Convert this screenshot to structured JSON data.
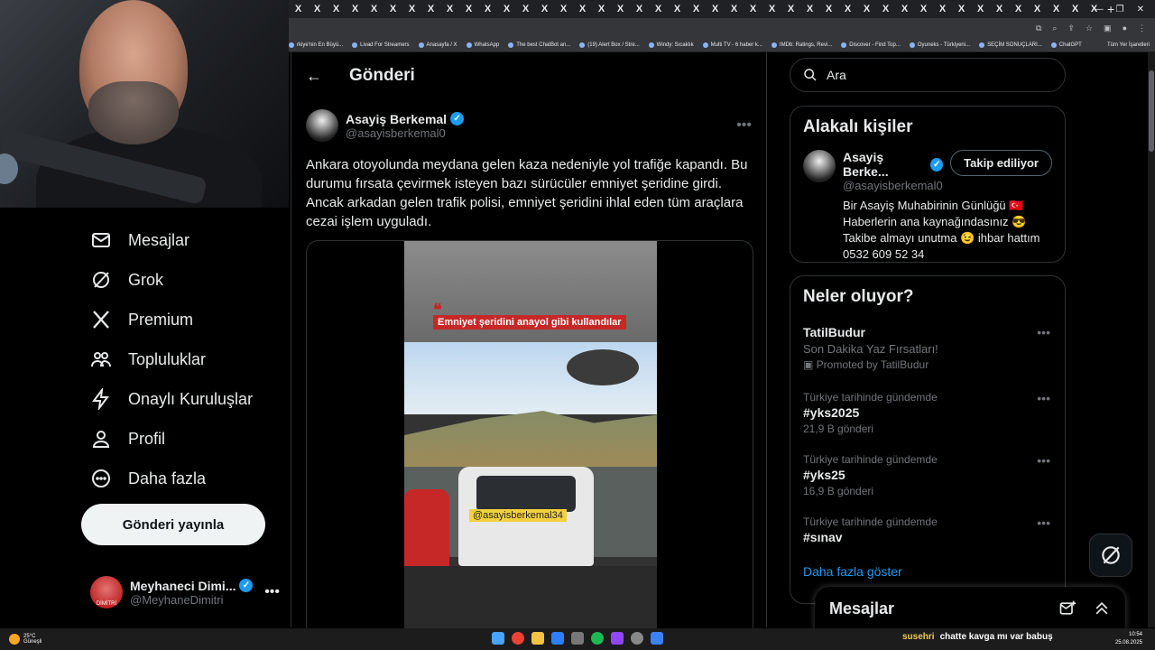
{
  "browser": {
    "tabs": [
      "X",
      "X",
      "X",
      "X",
      "X",
      "X",
      "X",
      "X",
      "X",
      "X",
      "X",
      "X",
      "X",
      "X",
      "X",
      "X",
      "X",
      "X",
      "X",
      "X",
      "X",
      "X",
      "X",
      "X",
      "X",
      "X",
      "X",
      "X",
      "X",
      "X",
      "X",
      "X",
      "X",
      "X",
      "X",
      "X",
      "X",
      "X",
      "X",
      "X",
      "X",
      "X",
      "X"
    ],
    "bookmarks": [
      "rkiye'nin En Büyü...",
      "Livad For Streamers",
      "Anasayfa / X",
      "WhatsApp",
      "The best ChatBot an...",
      "(19) Alert Box / Stre...",
      "Windy: Sıcaklık",
      "Multi TV - 6 haber k...",
      "IMDb: Ratings, Revi...",
      "Discover - Find Top...",
      "Oyuneks - Türkiyeni...",
      "SEÇİM SONUÇLARI...",
      "ChatGPT"
    ],
    "bookmarks_right": "Tüm Yer İşaretleri"
  },
  "nav": {
    "items": [
      {
        "label": "Mesajlar",
        "icon": "mail-icon"
      },
      {
        "label": "Grok",
        "icon": "grok-icon"
      },
      {
        "label": "Premium",
        "icon": "x-logo-icon"
      },
      {
        "label": "Topluluklar",
        "icon": "people-icon"
      },
      {
        "label": "Onaylı Kuruluşlar",
        "icon": "lightning-icon"
      },
      {
        "label": "Profil",
        "icon": "person-icon"
      },
      {
        "label": "Daha fazla",
        "icon": "more-circle-icon"
      }
    ],
    "post_button": "Gönderi yayınla",
    "account": {
      "name": "Meyhaneci Dimi...",
      "handle": "@MeyhaneDimitri",
      "avatar_text": "DİMİTRİ"
    }
  },
  "main": {
    "title": "Gönderi",
    "tweet": {
      "author": "Asayiş Berkemal",
      "handle": "@asayisberkemal0",
      "text": "Ankara otoyolunda meydana gelen kaza nedeniyle yol trafiğe kapandı. Bu durumu fırsata çevirmek isteyen bazı sürücüler emniyet şeridine girdi. Ancak arkadan gelen trafik polisi, emniyet şeridini ihlal eden tüm araçlara cezai işlem uyguladı.",
      "video_banner": "Emniyet şeridini anayol gibi kullandılar",
      "video_handle": "@asayisberkemal34"
    }
  },
  "search": {
    "placeholder": "Ara"
  },
  "related": {
    "title": "Alakalı kişiler",
    "person": {
      "name": "Asayiş Berke...",
      "handle": "@asayisberkemal0",
      "follow_label": "Takip ediliyor",
      "bio_line1": "Bir Asayiş Muhabirinin Günlüğü 🇹🇷",
      "bio_line2": "Haberlerin ana kaynağındasınız 😎",
      "bio_line3": "Takibe almayı unutma 😉 ihbar hattım",
      "bio_line4": "0532 609 52 34"
    }
  },
  "trends": {
    "title": "Neler oluyor?",
    "items": [
      {
        "context": "",
        "name": "TatilBudur",
        "sub": "Son Dakika Yaz Fırsatları!",
        "meta": "Promoted by TatilBudur"
      },
      {
        "context": "Türkiye tarihinde gündemde",
        "name": "#yks2025",
        "sub": "21,9 B gönderi"
      },
      {
        "context": "Türkiye tarihinde gündemde",
        "name": "#yks25",
        "sub": "16,9 B gönderi"
      },
      {
        "context": "Türkiye tarihinde gündemde",
        "name": "#sınav",
        "sub": ""
      }
    ],
    "show_more": "Daha fazla göster"
  },
  "messages_drawer": {
    "title": "Mesajlar"
  },
  "taskbar": {
    "temp": "25°C",
    "weather": "Güneşli",
    "chat_user": "susehri",
    "chat_message": "chatte kavga mı var babuş",
    "time": "10:54",
    "date": "25.08.2025"
  }
}
